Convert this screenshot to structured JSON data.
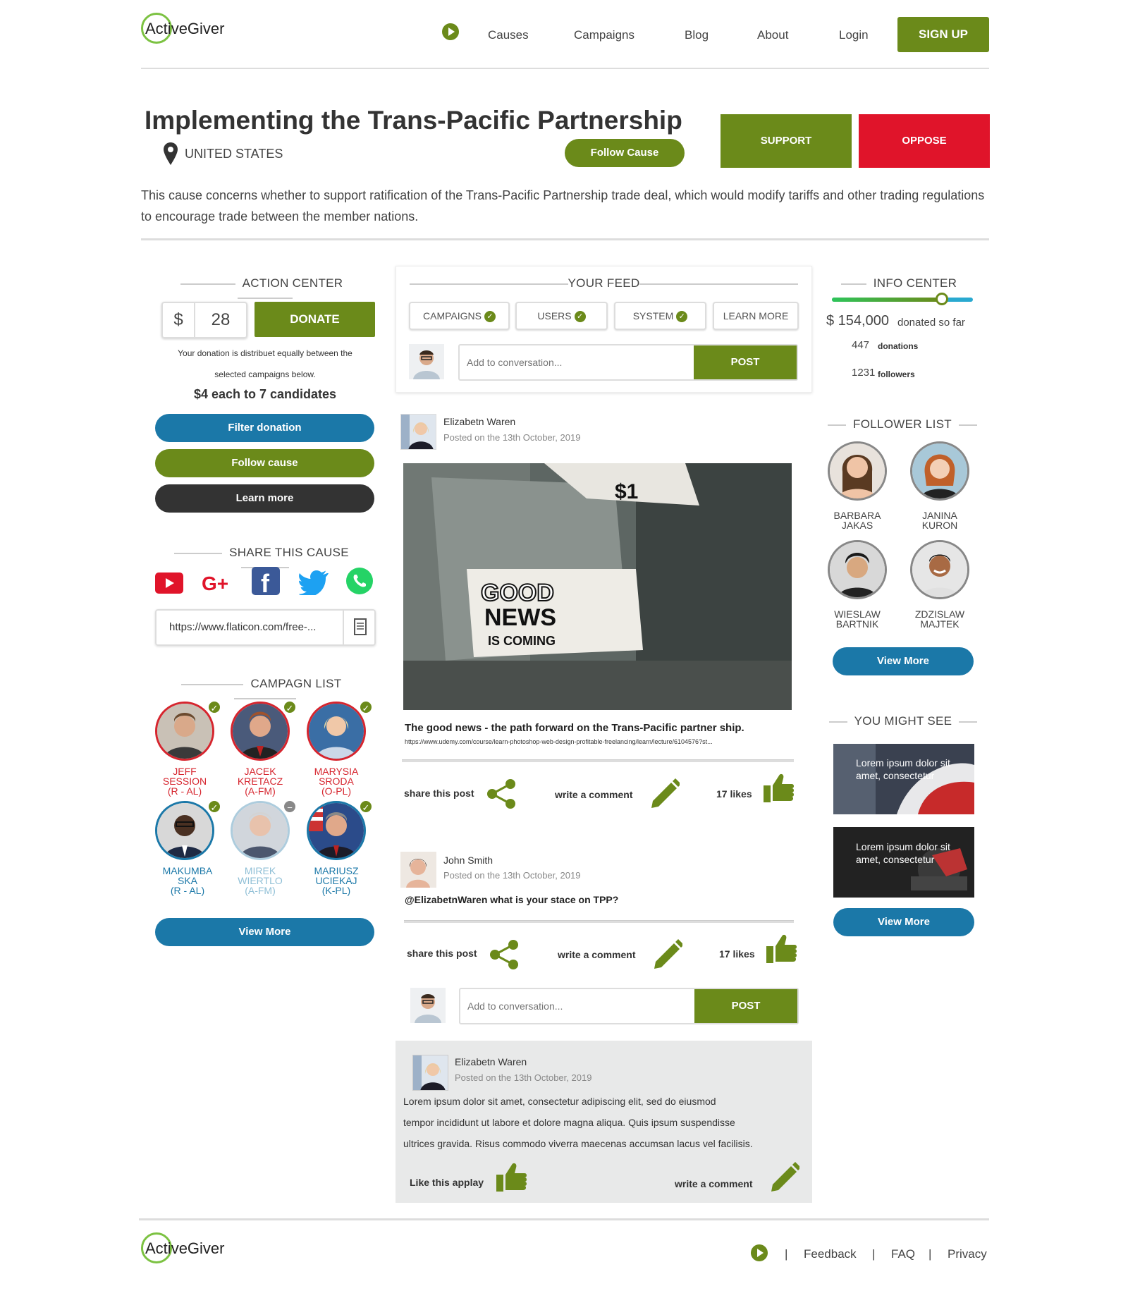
{
  "header": {
    "logo_prefix": "Act",
    "logo_i": "i",
    "logo_suffix": "veGiver",
    "nav": [
      "Causes",
      "Campaigns",
      "Blog",
      "About",
      "Login"
    ],
    "signup": "SIGN UP"
  },
  "cause": {
    "title": "Implementing the Trans-Pacific Partnership",
    "location": "UNITED STATES",
    "follow": "Follow Cause",
    "support": "SUPPORT",
    "oppose": "OPPOSE",
    "description": "This cause concerns whether to support ratification of the Trans-Pacific Partnership trade deal, which would modify tariffs and other trading regulations to encourage trade between the member nations."
  },
  "action_center": {
    "title": "ACTION CENTER",
    "currency": "$",
    "amount": "28",
    "donate": "DONATE",
    "note_line1": "Your donation is distribuet equally between the",
    "note_line2": "selected campaigns below.",
    "split": "$4 each to 7 candidates",
    "filter": "Filter donation",
    "follow": "Follow cause",
    "learn": "Learn more"
  },
  "share": {
    "title": "SHARE THIS CAUSE",
    "url": "https://www.flaticon.com/free-..."
  },
  "campaign_list": {
    "title": "CAMPAGN LIST",
    "candidates": [
      {
        "name1": "JEFF",
        "name2": "SESSION",
        "party": "(R - AL)",
        "status": "selected"
      },
      {
        "name1": "JACEK",
        "name2": "KRETACZ",
        "party": "(A-FM)",
        "status": "selected"
      },
      {
        "name1": "MARYSIA",
        "name2": "SRODA",
        "party": "(O-PL)",
        "status": "selected"
      },
      {
        "name1": "MAKUMBA",
        "name2": "SKA",
        "party": "(R - AL)",
        "status": "selected"
      },
      {
        "name1": "MIREK",
        "name2": "WIERTLO",
        "party": "(A-FM)",
        "status": "removed"
      },
      {
        "name1": "MARIUSZ",
        "name2": "UCIEKAJ",
        "party": "(K-PL)",
        "status": "selected"
      }
    ],
    "view_more": "View More"
  },
  "feed": {
    "title": "YOUR FEED",
    "tabs": [
      "CAMPAIGNS",
      "USERS",
      "SYSTEM",
      "LEARN MORE"
    ],
    "placeholder": "Add to conversation...",
    "post": "POST"
  },
  "posts": [
    {
      "author": "Elizabetn Waren",
      "date": "Posted on the 13th October, 2019",
      "image_text": "GOOD NEWS IS COMING",
      "image_price": "$1",
      "headline": "The good news - the path forward on the Trans-Pacific partner ship.",
      "link": "https://www.udemy.com/course/learn-photoshop-web-design-profitable-freelancing/learn/lecture/6104576?st...",
      "share": "share this post",
      "comment": "write a comment",
      "likes": "17 likes"
    },
    {
      "author": "John Smith",
      "date": "Posted on the 13th October, 2019",
      "text": "@ElizabetnWaren what is your stace on TPP?",
      "share": "share this post",
      "comment": "write a comment",
      "likes": "17 likes"
    }
  ],
  "reply": {
    "author": "Elizabetn Waren",
    "date": "Posted on the 13th October, 2019",
    "line1": "Lorem ipsum dolor sit amet, consectetur adipiscing elit, sed do eiusmod",
    "line2": "tempor incididunt ut labore et dolore magna aliqua. Quis ipsum suspendisse",
    "line3": "ultrices gravida. Risus commodo viverra maecenas accumsan lacus vel facilisis.",
    "like": "Like this applay",
    "comment": "write a comment"
  },
  "info_center": {
    "title": "INFO CENTER",
    "progress_fraction": 0.78,
    "amount": "$ 154,000",
    "amount_label": "donated so far",
    "donations": "447",
    "donations_label": "donations",
    "followers": "1231",
    "followers_label": "followers"
  },
  "follower_list": {
    "title": "FOLLOWER LIST",
    "followers": [
      {
        "first": "BARBARA",
        "last": "JAKAS"
      },
      {
        "first": "JANINA",
        "last": "KURON"
      },
      {
        "first": "WIESLAW",
        "last": "BARTNIK"
      },
      {
        "first": "ZDZISLAW",
        "last": "MAJTEK"
      }
    ],
    "view_more": "View More"
  },
  "might_see": {
    "title": "YOU MIGHT SEE",
    "cards": [
      "Lorem ipsum dolor sit amet, consectetur",
      "Lorem ipsum dolor sit amet, consectetur"
    ],
    "view_more": "View More"
  },
  "footer": {
    "links": [
      "Feedback",
      "FAQ",
      "Privacy"
    ],
    "separator": "|"
  },
  "colors": {
    "olive": "#6b8a1a",
    "red": "#e0142a",
    "blue": "#1b78a8",
    "dark": "#333333"
  }
}
